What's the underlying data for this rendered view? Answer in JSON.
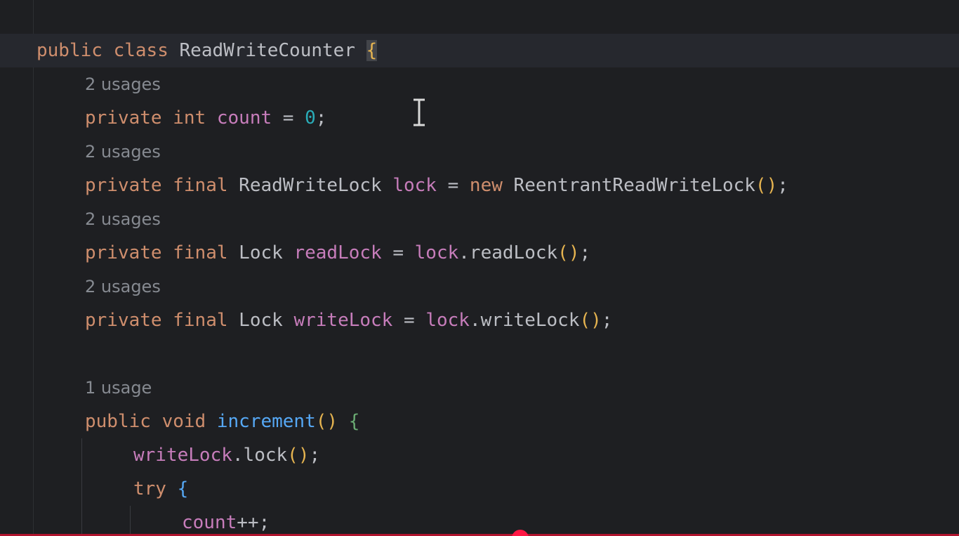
{
  "colors": {
    "background": "#1e1f22",
    "current_line": "#26282e",
    "keyword": "#cf8e6d",
    "field": "#c77dbb",
    "number": "#2aacb8",
    "method": "#56a8f5",
    "paren": "#e6b450",
    "text": "#bcbec4",
    "hint": "#868a91"
  },
  "code": {
    "class_decl": {
      "kw_public": "public",
      "kw_class": "class",
      "class_name": "ReadWriteCounter",
      "brace": "{"
    },
    "hints": {
      "count_usages": "2 usages",
      "lock_usages": "2 usages",
      "read_lock_usages": "2 usages",
      "write_lock_usages": "2 usages",
      "increment_usages": "1 usage"
    },
    "count_field": {
      "kw_private": "private",
      "kw_int": "int",
      "name": "count",
      "op": "=",
      "value": "0",
      "semi": ";"
    },
    "lock_field": {
      "kw_private": "private",
      "kw_final": "final",
      "type": "ReadWriteLock",
      "name": "lock",
      "op": "=",
      "kw_new": "new",
      "ctor": "ReentrantReadWriteLock",
      "parens": "()",
      "semi": ";"
    },
    "read_lock_field": {
      "kw_private": "private",
      "kw_final": "final",
      "type": "Lock",
      "name": "readLock",
      "op": "=",
      "target": "lock",
      "method": ".readLock",
      "parens": "()",
      "semi": ";"
    },
    "write_lock_field": {
      "kw_private": "private",
      "kw_final": "final",
      "type": "Lock",
      "name": "writeLock",
      "op": "=",
      "target": "lock",
      "method": ".writeLock",
      "parens": "()",
      "semi": ";"
    },
    "increment_decl": {
      "kw_public": "public",
      "kw_void": "void",
      "name": "increment",
      "parens": "()",
      "brace": "{"
    },
    "write_lock_call": {
      "target": "writeLock",
      "method": ".lock",
      "parens": "()",
      "semi": ";"
    },
    "try_line": {
      "kw_try": "try",
      "brace": "{"
    },
    "count_increment": {
      "name": "count",
      "op": "++;"
    }
  }
}
